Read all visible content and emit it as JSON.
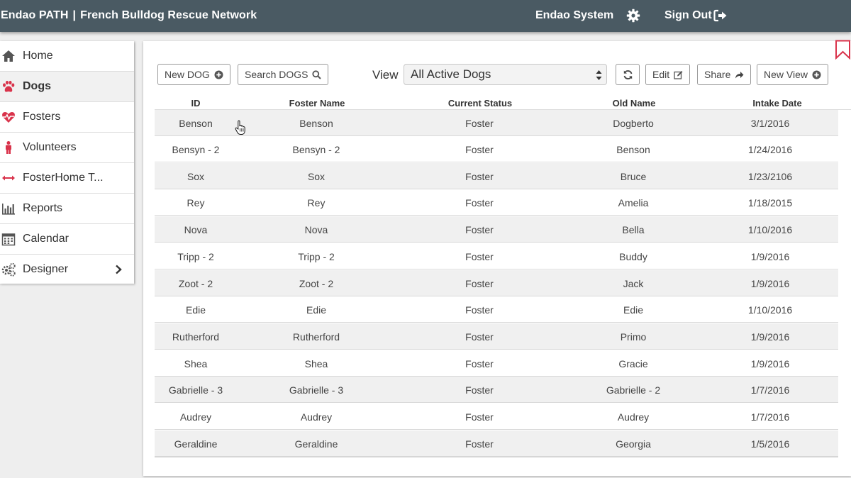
{
  "header": {
    "app_name": "Endao PATH",
    "separator": "|",
    "org_name": "French Bulldog Rescue Network",
    "system_label": "Endao System",
    "gear_icon": "gear-icon",
    "signout_label": "Sign Out",
    "signout_icon": "sign-out-icon",
    "bg_color": "#4a5a63"
  },
  "sidebar": {
    "items": [
      {
        "label": "Home",
        "icon": "home-icon",
        "active": false
      },
      {
        "label": "Dogs",
        "icon": "paw-icon",
        "active": true
      },
      {
        "label": "Fosters",
        "icon": "heartbeat-icon",
        "active": false
      },
      {
        "label": "Volunteers",
        "icon": "person-icon",
        "active": false
      },
      {
        "label": "FosterHome T...",
        "icon": "arrows-horizontal-icon",
        "active": false
      },
      {
        "label": "Reports",
        "icon": "bar-chart-icon",
        "active": false
      },
      {
        "label": "Calendar",
        "icon": "calendar-icon",
        "active": false
      },
      {
        "label": "Designer",
        "icon": "gears-icon",
        "active": false,
        "submenu": true
      }
    ],
    "accent_color": "#d9334b"
  },
  "toolbar": {
    "new_dog_label": "New DOG",
    "search_dogs_label": "Search DOGS",
    "view_label": "View",
    "view_selected": "All Active Dogs",
    "refresh_icon": "refresh-icon",
    "edit_label": "Edit",
    "share_label": "Share",
    "new_view_label": "New View"
  },
  "table": {
    "columns": [
      "ID",
      "Foster Name",
      "Current Status",
      "Old Name",
      "Intake Date"
    ],
    "rows": [
      [
        "Benson",
        "Benson",
        "Foster",
        "Dogberto",
        "3/1/2016"
      ],
      [
        "Bensyn - 2",
        "Bensyn - 2",
        "Foster",
        "Benson",
        "1/24/2016"
      ],
      [
        "Sox",
        "Sox",
        "Foster",
        "Bruce",
        "1/23/2106"
      ],
      [
        "Rey",
        "Rey",
        "Foster",
        "Amelia",
        "1/18/2015"
      ],
      [
        "Nova",
        "Nova",
        "Foster",
        "Bella",
        "1/10/2016"
      ],
      [
        "Tripp - 2",
        "Tripp - 2",
        "Foster",
        "Buddy",
        "1/9/2016"
      ],
      [
        "Zoot - 2",
        "Zoot - 2",
        "Foster",
        "Jack",
        "1/9/2016"
      ],
      [
        "Edie",
        "Edie",
        "Foster",
        "Edie",
        "1/10/2016"
      ],
      [
        "Rutherford",
        "Rutherford",
        "Foster",
        "Primo",
        "1/9/2016"
      ],
      [
        "Shea",
        "Shea",
        "Foster",
        "Gracie",
        "1/9/2016"
      ],
      [
        "Gabrielle - 3",
        "Gabrielle - 3",
        "Foster",
        "Gabrielle - 2",
        "1/7/2016"
      ],
      [
        "Audrey",
        "Audrey",
        "Foster",
        "Audrey",
        "1/7/2016"
      ],
      [
        "Geraldine",
        "Geraldine",
        "Foster",
        "Georgia",
        "1/5/2016"
      ]
    ]
  }
}
